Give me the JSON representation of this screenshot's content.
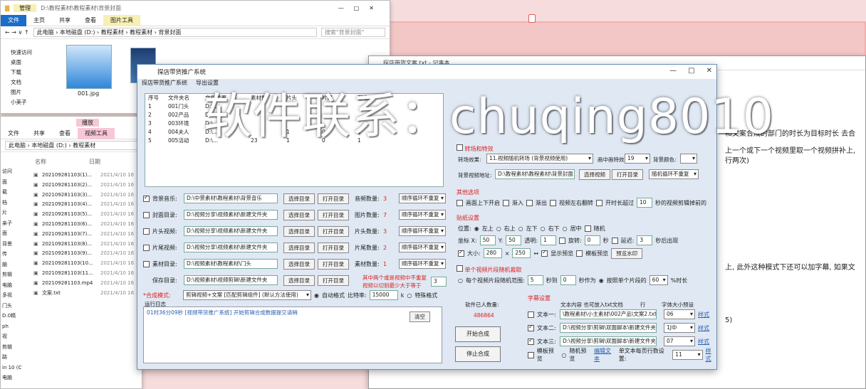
{
  "colors": {
    "accent": "#1a6dc8",
    "warning_red": "#dd2222",
    "app_bg": "#dfe8f3"
  },
  "explorer_top": {
    "tabs": [
      "文件",
      "主页",
      "共享",
      "查看",
      "图片工具"
    ],
    "manage_tab": "管理",
    "window_path": "D:\\教程素材\\教程素材\\背景封面",
    "address": "此电脑 › 本地磁盘 (D:) › 教程素材 › 教程素材 › 背景封面",
    "search": "搜索\"背景封面\"",
    "nav": [
      "快速访问",
      "桌面",
      "下载",
      "文档",
      "图片",
      "小美子"
    ],
    "file1": "001.jpg"
  },
  "explorer_bottom": {
    "tabs": [
      "文件",
      "共享",
      "查看",
      "视频工具"
    ],
    "manage_tab": "播放",
    "address": "此电脑 › 本地磁盘 (D:) › 教程素材",
    "col_name": "名称",
    "col_date": "日期",
    "nav": [
      "访问",
      "面",
      "载",
      "档",
      "片",
      "亲子",
      "面",
      "背景",
      "传",
      "脑",
      "剪辑",
      "电脑",
      "多视",
      "门头",
      "D.0精",
      "ph",
      "视",
      "剪辑",
      "路",
      "in 10 (C",
      "电脑"
    ],
    "files": [
      {
        "name": "20210928110​3(1)...",
        "date": "2021/4/10 16"
      },
      {
        "name": "20210928110​3(2)...",
        "date": "2021/4/10 16"
      },
      {
        "name": "20210928110​3(3)...",
        "date": "2021/4/10 16"
      },
      {
        "name": "20210928110​3(4)...",
        "date": "2021/4/10 16"
      },
      {
        "name": "20210928110​3(5)...",
        "date": "2021/4/10 16"
      },
      {
        "name": "20210928110​3(6)...",
        "date": "2021/4/10 16"
      },
      {
        "name": "20210928110​3(7)...",
        "date": "2021/4/10 16"
      },
      {
        "name": "20210928110​3(8)...",
        "date": "2021/4/10 16"
      },
      {
        "name": "20210928110​3(9)...",
        "date": "2021/4/10 16"
      },
      {
        "name": "20210928110​3(10...",
        "date": "2021/4/10 16"
      },
      {
        "name": "20210928110​3(11...",
        "date": "2021/4/10 16"
      },
      {
        "name": "20210928110​3.mp4",
        "date": "2021/4/10 16"
      },
      {
        "name": "文案.txt",
        "date": "2021/4/10 16"
      }
    ]
  },
  "notepad": {
    "title": "探店带货文案.txt - 记事本",
    "lines": [
      "和文案合成的部门的时长为目标时长 去合",
      "上一个或下一个视频里取一个视频拼补上,",
      "行两次)",
      "上, 此外这种模式下还可以加字幕, 如果文",
      "5)"
    ]
  },
  "app": {
    "title": "探店带货推广系统",
    "menu": [
      "探店带货推广系统",
      "导出设置"
    ],
    "list_headers": [
      "序号",
      "文件夹名",
      "文件位置",
      "素材数",
      "片头",
      "片尾",
      "配音"
    ],
    "list_rows": [
      [
        "1",
        "001门头",
        "D:\\...",
        "",
        "",
        "",
        ""
      ],
      [
        "2",
        "002产品",
        "D:\\...",
        "",
        "",
        "",
        ""
      ],
      [
        "3",
        "003环境",
        "D:\\...",
        "",
        "",
        "",
        ""
      ],
      [
        "4",
        "004夫人",
        "D:\\...",
        "",
        "1",
        "0",
        "1"
      ],
      [
        "5",
        "005活动",
        "D:\\...",
        "23",
        "1",
        "0",
        "1"
      ]
    ],
    "rows": [
      {
        "label": "背景音乐:",
        "path": "D:\\中景素材\\教程素材\\背景音乐",
        "btn1": "选择目录",
        "btn2": "打开目录",
        "count_label": "音频数量:",
        "count": "3",
        "mode": "顺序循环不重复"
      },
      {
        "label": "封面目录:",
        "path": "D:\\视频分享\\视频素材\\新建文件夹",
        "btn1": "选择目录",
        "btn2": "打开目录",
        "count_label": "图片数量:",
        "count": "7",
        "mode": "顺序循环不重复"
      },
      {
        "label": "片头视频:",
        "path": "D:\\视频分享\\视频素材\\新建文件夹",
        "btn1": "选择目录",
        "btn2": "打开目录",
        "count_label": "片头数量:",
        "count": "3",
        "mode": "顺序循环不重复"
      },
      {
        "label": "片尾视频:",
        "path": "D:\\视频分享\\视频素材\\新建文件夹",
        "btn1": "选择目录",
        "btn2": "打开目录",
        "count_label": "片尾数量:",
        "count": "2",
        "mode": "顺序循环不重复"
      },
      {
        "label": "素材目录:",
        "path": "D:\\视频素材\\教程素材\\门头",
        "btn1": "选择目录",
        "btn2": "打开目录",
        "count_label": "素材数量:",
        "count": "1",
        "mode": "顺序循环不重复"
      },
      {
        "label": "保存目录:",
        "path": "D:\\视频素材\\视频剪辑\\新建文件夹",
        "btn1": "选择目录",
        "btn2": "打开目录",
        "count_label": "",
        "count": "",
        "mode": ""
      }
    ],
    "red_note_1": "其中两个或是视频中不重复",
    "red_note_2": "视频以切割最少大于等于",
    "red_note_value": "3",
    "output_label": "*合成模式:",
    "output_mode": "剪辑视频+文案 [匹配剪辑组件] (默认方法使用)",
    "auto_format": "自动格式",
    "bitrate_label": "比特率:",
    "bitrate": "15000",
    "bitrate_unit": "k",
    "special_format": "特殊格式",
    "log_label": "运行日志",
    "log_line": "01时36分09秒 [视频带货推广系统] 开始剪辑合成数据提交请稍",
    "clear_btn": "清空",
    "counter_label": "软件已人数量:",
    "counter_value": "486864",
    "start_btn": "开始合成",
    "stop_btn": "停止合成",
    "transition_title": "转场和特效",
    "transition_label": "转场效果:",
    "transition_value": "11.视频随机转场 (背景视频使用)",
    "pip_label": "画中画特效:",
    "pip_value": "19",
    "bg_color_label": "背景颜色:",
    "bg_video_label": "背景视频地址:",
    "bg_video_path": "D:\\教程素材\\教程素材\\背景封面",
    "bg_btn1": "选择视频",
    "bg_btn2": "打开目录",
    "bg_mode": "随机循环不重复",
    "other_title": "其他选项",
    "other_opts": [
      "画面上下开启",
      "渐入",
      "渐出",
      "视频左右翻转",
      "开时长超过"
    ],
    "other_value": "10",
    "other_suffix": "秒的视频剪辑掉前的",
    "sticker_title": "贴纸设置",
    "pos_label": "位置:",
    "pos_opts": [
      "左上",
      "右上",
      "左下",
      "右下",
      "居中",
      "随机"
    ],
    "coord_label": "坐标 X:",
    "x_val": "50",
    "y_label": "Y:",
    "y_val": "50",
    "opacity_label": "透明:",
    "opacity_val": "1",
    "rotate_label": "旋转:",
    "rotate_val": "0",
    "rotate_unit": "秒",
    "delay_label": "延迟:",
    "delay_val": "3",
    "delay_suffix": "秒后出现",
    "size_label": "大小:",
    "w_val": "280",
    "h_val": "250",
    "size_opt1": "显示预览",
    "size_opt2": "模板预览",
    "preview_btn": "预览水印",
    "split_title": "单个视频片段随机裁取",
    "split_opt1": "每个视频片段随机范围:",
    "split_from": "5",
    "split_to": "0",
    "split_mid": "秒到",
    "split_unit": "秒作为",
    "split_opt2": "按照单个片段的",
    "split_pct": "60",
    "split_pct_unit": "%时长",
    "subtitle_title": "字幕设置",
    "sub_header_content": "文本内容 也可放入txt文档",
    "sub_header_row": "行",
    "sub_header_size": "字体大小预设",
    "sub_rows": [
      {
        "label": "文本一:",
        "path": "\\教程素材\\小主素材\\002产品\\文案2.txt",
        "size": "06",
        "link": "样式"
      },
      {
        "label": "文本二:",
        "path": "D:\\视频分享\\剪辑\\双面脚本\\新建文件夹",
        "size": "1J中",
        "link": "样式"
      },
      {
        "label": "文本三:",
        "path": "D:\\视频分享\\剪辑\\双面脚本\\新建文件夹",
        "size": "07",
        "link": "样式"
      }
    ],
    "sub_bottom_opt1": "模板预览",
    "sub_bottom_opt2": "随机预览",
    "sub_bottom_link": "编辑文本",
    "sub_bottom_label": "单文本每页行数设置:",
    "sub_bottom_value": "11",
    "sub_bottom_link2": "样式"
  },
  "watermark": "软件联系：chuqing8010"
}
